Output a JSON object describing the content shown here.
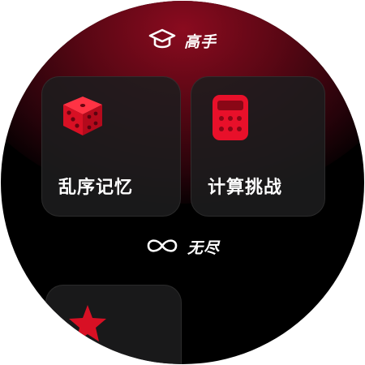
{
  "sections": {
    "advanced": {
      "label": "高手",
      "icon": "graduation-cap-icon"
    },
    "endless": {
      "label": "无尽",
      "icon": "infinity-icon"
    }
  },
  "modes": [
    {
      "title": "乱序记忆",
      "icon": "dice-icon"
    },
    {
      "title": "计算挑战",
      "icon": "calculator-icon"
    },
    {
      "title": "",
      "icon": "star-icon"
    }
  ],
  "colors": {
    "accent": "#e8102a",
    "background": "#000000",
    "card": "#1c1c1e"
  }
}
